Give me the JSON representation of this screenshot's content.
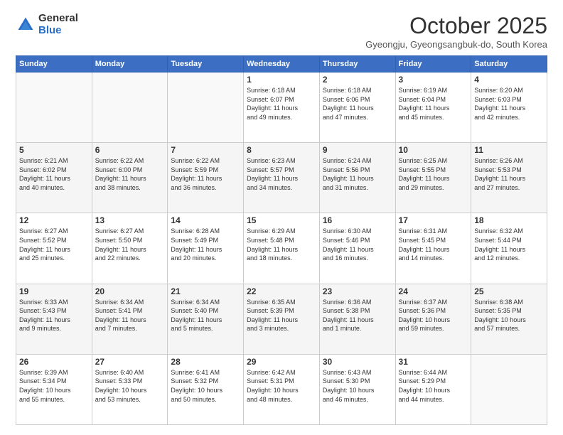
{
  "logo": {
    "general": "General",
    "blue": "Blue"
  },
  "header": {
    "month": "October 2025",
    "location": "Gyeongju, Gyeongsangbuk-do, South Korea"
  },
  "weekdays": [
    "Sunday",
    "Monday",
    "Tuesday",
    "Wednesday",
    "Thursday",
    "Friday",
    "Saturday"
  ],
  "weeks": [
    [
      {
        "day": "",
        "info": ""
      },
      {
        "day": "",
        "info": ""
      },
      {
        "day": "",
        "info": ""
      },
      {
        "day": "1",
        "info": "Sunrise: 6:18 AM\nSunset: 6:07 PM\nDaylight: 11 hours\nand 49 minutes."
      },
      {
        "day": "2",
        "info": "Sunrise: 6:18 AM\nSunset: 6:06 PM\nDaylight: 11 hours\nand 47 minutes."
      },
      {
        "day": "3",
        "info": "Sunrise: 6:19 AM\nSunset: 6:04 PM\nDaylight: 11 hours\nand 45 minutes."
      },
      {
        "day": "4",
        "info": "Sunrise: 6:20 AM\nSunset: 6:03 PM\nDaylight: 11 hours\nand 42 minutes."
      }
    ],
    [
      {
        "day": "5",
        "info": "Sunrise: 6:21 AM\nSunset: 6:02 PM\nDaylight: 11 hours\nand 40 minutes."
      },
      {
        "day": "6",
        "info": "Sunrise: 6:22 AM\nSunset: 6:00 PM\nDaylight: 11 hours\nand 38 minutes."
      },
      {
        "day": "7",
        "info": "Sunrise: 6:22 AM\nSunset: 5:59 PM\nDaylight: 11 hours\nand 36 minutes."
      },
      {
        "day": "8",
        "info": "Sunrise: 6:23 AM\nSunset: 5:57 PM\nDaylight: 11 hours\nand 34 minutes."
      },
      {
        "day": "9",
        "info": "Sunrise: 6:24 AM\nSunset: 5:56 PM\nDaylight: 11 hours\nand 31 minutes."
      },
      {
        "day": "10",
        "info": "Sunrise: 6:25 AM\nSunset: 5:55 PM\nDaylight: 11 hours\nand 29 minutes."
      },
      {
        "day": "11",
        "info": "Sunrise: 6:26 AM\nSunset: 5:53 PM\nDaylight: 11 hours\nand 27 minutes."
      }
    ],
    [
      {
        "day": "12",
        "info": "Sunrise: 6:27 AM\nSunset: 5:52 PM\nDaylight: 11 hours\nand 25 minutes."
      },
      {
        "day": "13",
        "info": "Sunrise: 6:27 AM\nSunset: 5:50 PM\nDaylight: 11 hours\nand 22 minutes."
      },
      {
        "day": "14",
        "info": "Sunrise: 6:28 AM\nSunset: 5:49 PM\nDaylight: 11 hours\nand 20 minutes."
      },
      {
        "day": "15",
        "info": "Sunrise: 6:29 AM\nSunset: 5:48 PM\nDaylight: 11 hours\nand 18 minutes."
      },
      {
        "day": "16",
        "info": "Sunrise: 6:30 AM\nSunset: 5:46 PM\nDaylight: 11 hours\nand 16 minutes."
      },
      {
        "day": "17",
        "info": "Sunrise: 6:31 AM\nSunset: 5:45 PM\nDaylight: 11 hours\nand 14 minutes."
      },
      {
        "day": "18",
        "info": "Sunrise: 6:32 AM\nSunset: 5:44 PM\nDaylight: 11 hours\nand 12 minutes."
      }
    ],
    [
      {
        "day": "19",
        "info": "Sunrise: 6:33 AM\nSunset: 5:43 PM\nDaylight: 11 hours\nand 9 minutes."
      },
      {
        "day": "20",
        "info": "Sunrise: 6:34 AM\nSunset: 5:41 PM\nDaylight: 11 hours\nand 7 minutes."
      },
      {
        "day": "21",
        "info": "Sunrise: 6:34 AM\nSunset: 5:40 PM\nDaylight: 11 hours\nand 5 minutes."
      },
      {
        "day": "22",
        "info": "Sunrise: 6:35 AM\nSunset: 5:39 PM\nDaylight: 11 hours\nand 3 minutes."
      },
      {
        "day": "23",
        "info": "Sunrise: 6:36 AM\nSunset: 5:38 PM\nDaylight: 11 hours\nand 1 minute."
      },
      {
        "day": "24",
        "info": "Sunrise: 6:37 AM\nSunset: 5:36 PM\nDaylight: 10 hours\nand 59 minutes."
      },
      {
        "day": "25",
        "info": "Sunrise: 6:38 AM\nSunset: 5:35 PM\nDaylight: 10 hours\nand 57 minutes."
      }
    ],
    [
      {
        "day": "26",
        "info": "Sunrise: 6:39 AM\nSunset: 5:34 PM\nDaylight: 10 hours\nand 55 minutes."
      },
      {
        "day": "27",
        "info": "Sunrise: 6:40 AM\nSunset: 5:33 PM\nDaylight: 10 hours\nand 53 minutes."
      },
      {
        "day": "28",
        "info": "Sunrise: 6:41 AM\nSunset: 5:32 PM\nDaylight: 10 hours\nand 50 minutes."
      },
      {
        "day": "29",
        "info": "Sunrise: 6:42 AM\nSunset: 5:31 PM\nDaylight: 10 hours\nand 48 minutes."
      },
      {
        "day": "30",
        "info": "Sunrise: 6:43 AM\nSunset: 5:30 PM\nDaylight: 10 hours\nand 46 minutes."
      },
      {
        "day": "31",
        "info": "Sunrise: 6:44 AM\nSunset: 5:29 PM\nDaylight: 10 hours\nand 44 minutes."
      },
      {
        "day": "",
        "info": ""
      }
    ]
  ]
}
